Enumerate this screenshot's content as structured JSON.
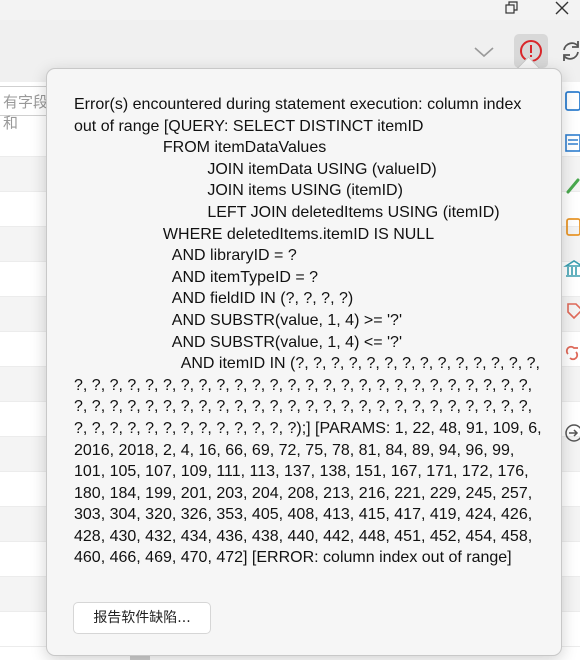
{
  "search": {
    "placeholder": "有字段和"
  },
  "error_popup": {
    "message": "Error(s) encountered during statement execution: column index out of range [QUERY: SELECT DISTINCT itemID\n                    FROM itemDataValues\n                              JOIN itemData USING (valueID)\n                              JOIN items USING (itemID)\n                              LEFT JOIN deletedItems USING (itemID)\n                    WHERE deletedItems.itemID IS NULL\n                      AND libraryID = ?\n                      AND itemTypeID = ?\n                      AND fieldID IN (?, ?, ?, ?)\n                      AND SUBSTR(value, 1, 4) >= '?'\n                      AND SUBSTR(value, 1, 4) <= '?'\n                        AND itemID IN (?, ?, ?, ?, ?, ?, ?, ?, ?, ?, ?, ?, ?, ?, ?, ?, ?, ?, ?, ?, ?, ?, ?, ?, ?, ?, ?, ?, ?, ?, ?, ?, ?, ?, ?, ?, ?, ?, ?, ?, ?, ?, ?, ?, ?, ?, ?, ?, ?, ?, ?, ?, ?, ?, ?, ?, ?, ?, ?, ?, ?, ?, ?, ?, ?, ?, ?, ?, ?, ?, ?, ?, ?, ?, ?, ?, ?, ?, ?);] [PARAMS: 1, 22, 48, 91, 109, 6, 2016, 2018, 2, 4, 16, 66, 69, 72, 75, 78, 81, 84, 89, 94, 96, 99, 101, 105, 107, 109, 111, 113, 137, 138, 151, 167, 171, 172, 176, 180, 184, 199, 201, 203, 204, 208, 213, 216, 221, 229, 245, 257, 303, 304, 320, 326, 353, 405, 408, 413, 415, 417, 419, 424, 426, 428, 430, 432, 434, 436, 438, 440, 442, 448, 451, 452, 454, 458, 460, 466, 469, 470, 472] [ERROR: column index out of range]",
    "report_button_label": "报告软件缺陷..."
  },
  "icons": {
    "alert": "exclamation-circle-icon",
    "refresh": "sync-icon",
    "restore": "window-restore-icon",
    "close": "close-icon",
    "chevron": "chevron-down-icon"
  },
  "colors": {
    "alert_red": "#d9262a",
    "side_blue": "#2f7fd0",
    "side_green": "#49a84e",
    "side_orange": "#e9972a",
    "side_teal": "#3a9fb0",
    "side_red": "#e06a5a"
  }
}
